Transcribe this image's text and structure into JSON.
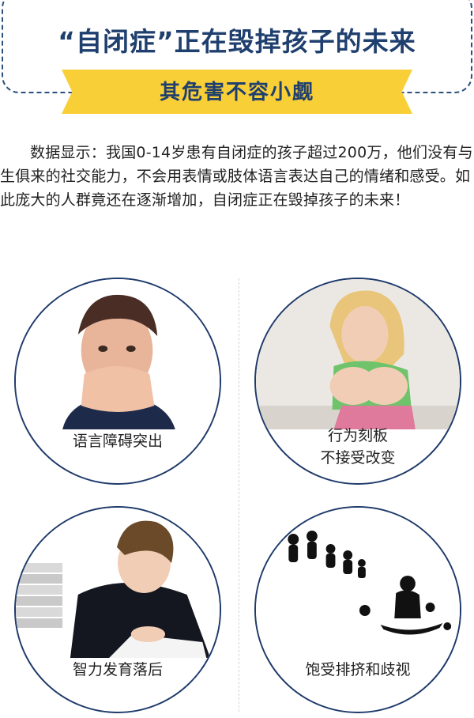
{
  "header": {
    "title": "“自闭症”正在毁掉孩子的未来",
    "subtitle": "其危害不容小觑"
  },
  "intro": {
    "text": "数据显示：我国0-14岁患有自闭症的孩子超过200万，他们没有与生俱来的社交能力，不会用表情或肢体语言表达自己的情绪和感受。如此庞大的人群竟还在逐渐增加，自闭症正在毁掉孩子的未来！"
  },
  "symptoms": [
    {
      "caption": "语言障碍突出"
    },
    {
      "caption_line1": "行为刻板",
      "caption_line2": "不接受改变"
    },
    {
      "caption": "智力发育落后"
    },
    {
      "caption": "饱受排挤和歧视"
    }
  ],
  "colors": {
    "navy": "#1f3f6e",
    "ribbon": "#f9cf38"
  }
}
